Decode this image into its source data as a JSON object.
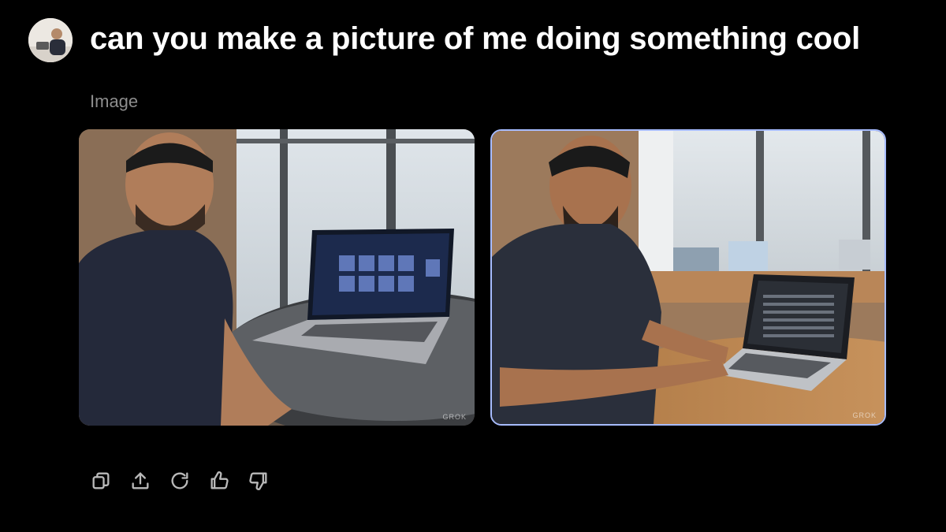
{
  "prompt": {
    "text": "can you make a picture of me doing something cool",
    "avatar_alt": "user avatar"
  },
  "response": {
    "section_label": "Image",
    "images": [
      {
        "watermark": "GROK",
        "selected": false
      },
      {
        "watermark": "GROK",
        "selected": true
      }
    ]
  },
  "actions": [
    {
      "icon": "copy-icon"
    },
    {
      "icon": "share-icon"
    },
    {
      "icon": "regenerate-icon"
    },
    {
      "icon": "thumbs-up-icon"
    },
    {
      "icon": "thumbs-down-icon"
    }
  ],
  "colors": {
    "background": "#000000",
    "text": "#ffffff",
    "muted": "#8d8d8d",
    "selection_border": "#a7bcff"
  }
}
